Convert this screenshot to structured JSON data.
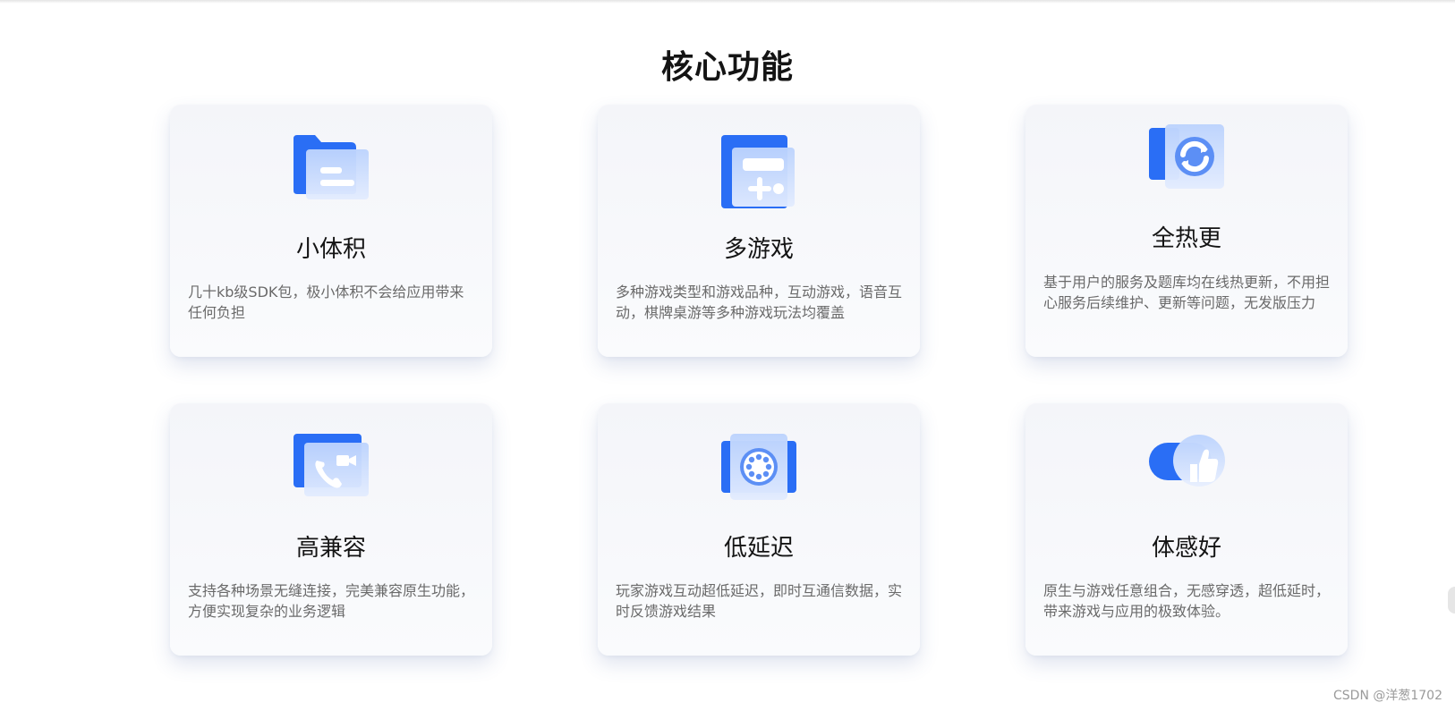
{
  "section": {
    "title": "核心功能"
  },
  "cards": [
    {
      "title": "小体积",
      "desc": "几十kb级SDK包，极小体积不会给应用带来任何负担",
      "icon": "folder-icon"
    },
    {
      "title": "多游戏",
      "desc": "多种游戏类型和游戏品种，互动游戏，语音互动，棋牌桌游等多种游戏玩法均覆盖",
      "icon": "game-controller-icon"
    },
    {
      "title": "全热更",
      "desc": "基于用户的服务及题库均在线热更新，不用担心服务后续维护、更新等问题，无发版压力",
      "icon": "refresh-icon"
    },
    {
      "title": "高兼容",
      "desc": "支持各种场景无缝连接，完美兼容原生功能，方便实现复杂的业务逻辑",
      "icon": "video-call-icon"
    },
    {
      "title": "低延迟",
      "desc": "玩家游戏互动超低延迟，即时互通信数据，实时反馈游戏结果",
      "icon": "loading-spinner-icon"
    },
    {
      "title": "体感好",
      "desc": "原生与游戏任意组合，无感穿透，超低延时，带来游戏与应用的极致体验。",
      "icon": "thumbs-up-icon"
    }
  ],
  "watermark": "CSDN @洋葱1702",
  "colors": {
    "accent": "#2a6ef5",
    "accent_light": "#a9c7fc",
    "title": "#141414",
    "desc": "#6a6a6a",
    "card_bg": "#f4f5f9"
  }
}
